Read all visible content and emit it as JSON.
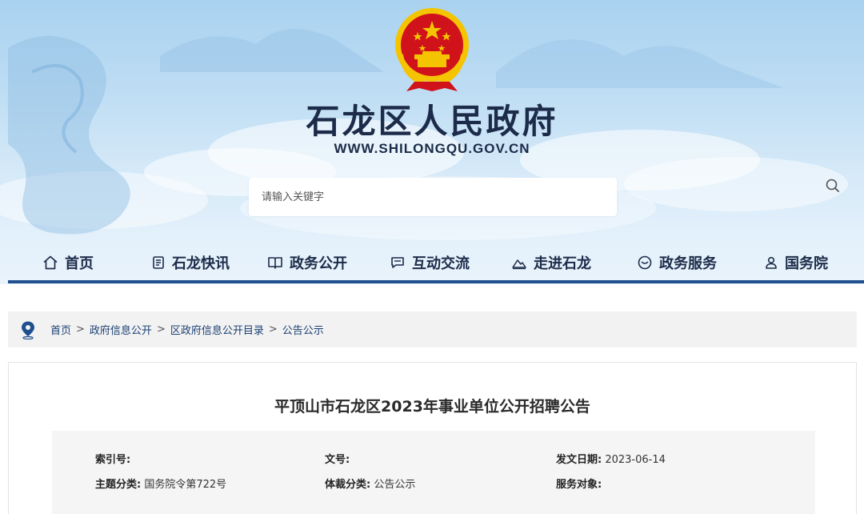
{
  "header": {
    "site_title": "石龙区人民政府",
    "site_url": "WWW.SHILONGQU.GOV.CN",
    "emblem_icon": "national-emblem-icon",
    "search": {
      "placeholder": "请输入关键字",
      "icon": "search-icon"
    }
  },
  "nav": {
    "items": [
      {
        "label": "首页",
        "icon": "home-icon"
      },
      {
        "label": "石龙快讯",
        "icon": "news-icon"
      },
      {
        "label": "政务公开",
        "icon": "book-icon"
      },
      {
        "label": "互动交流",
        "icon": "chat-icon"
      },
      {
        "label": "走进石龙",
        "icon": "mountain-icon"
      },
      {
        "label": "政务服务",
        "icon": "service-icon"
      },
      {
        "label": "国务院",
        "icon": "person-icon"
      }
    ]
  },
  "breadcrumb": {
    "icon": "location-pin-icon",
    "items": [
      "首页",
      "政府信息公开",
      "区政府信息公开目录",
      "公告公示"
    ],
    "separator": ">"
  },
  "article": {
    "title": "平顶山市石龙区2023年事业单位公开招聘公告",
    "meta": {
      "index_label": "索引号:",
      "index_value": "",
      "doc_no_label": "文号:",
      "doc_no_value": "",
      "date_label": "发文日期:",
      "date_value": "2023-06-14",
      "topic_label": "主题分类:",
      "topic_value": "国务院令第722号",
      "genre_label": "体裁分类:",
      "genre_value": "公告公示",
      "audience_label": "服务对象:",
      "audience_value": ""
    }
  },
  "colors": {
    "nav_text": "#1c2b49",
    "nav_bar": "#1f4f8f",
    "breadcrumb_link": "#1a3f73",
    "emblem_red": "#d0121b",
    "emblem_gold": "#f5c400"
  }
}
